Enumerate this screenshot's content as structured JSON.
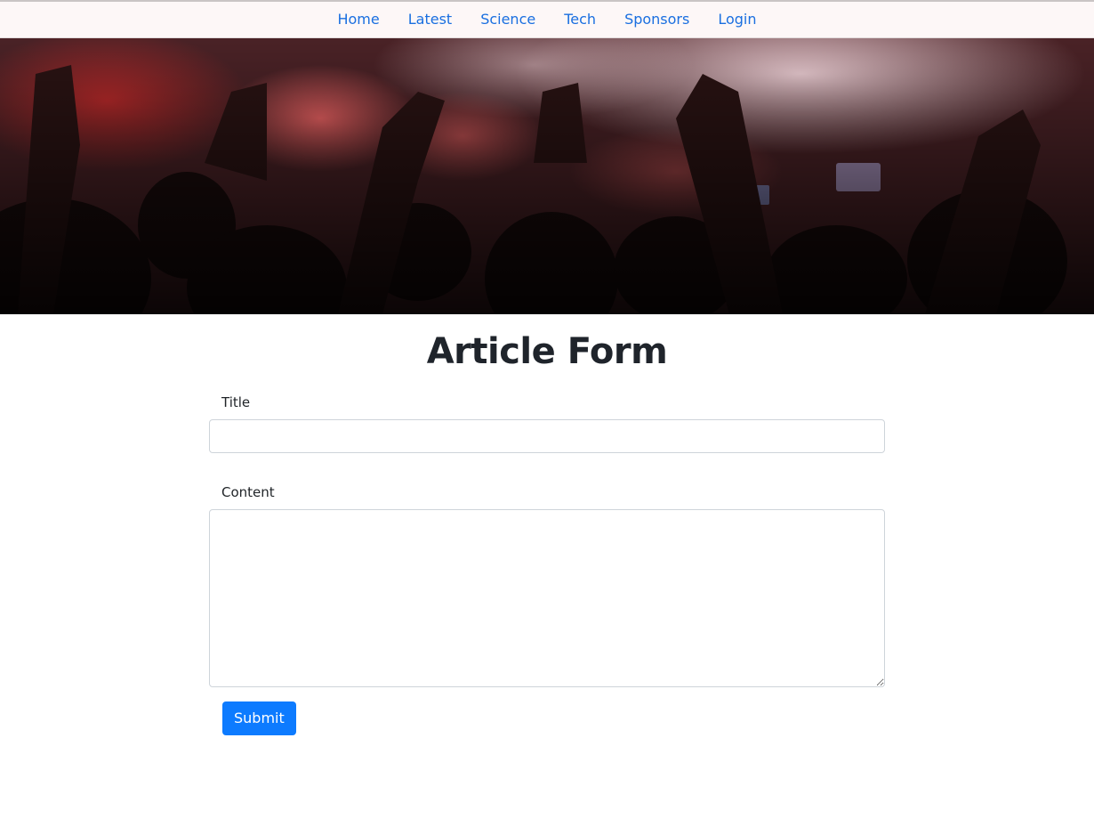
{
  "nav": {
    "items": [
      {
        "label": "Home"
      },
      {
        "label": "Latest"
      },
      {
        "label": "Science"
      },
      {
        "label": "Tech"
      },
      {
        "label": "Sponsors"
      },
      {
        "label": "Login"
      }
    ]
  },
  "hero": {
    "image": "concert-crowd-photo"
  },
  "form": {
    "heading": "Article Form",
    "title_label": "Title",
    "title_value": "",
    "content_label": "Content",
    "content_value": "",
    "submit_label": "Submit"
  },
  "colors": {
    "link": "#1a6fe0",
    "button": "#0d7bff",
    "nav_background": "#fdf7f7"
  }
}
